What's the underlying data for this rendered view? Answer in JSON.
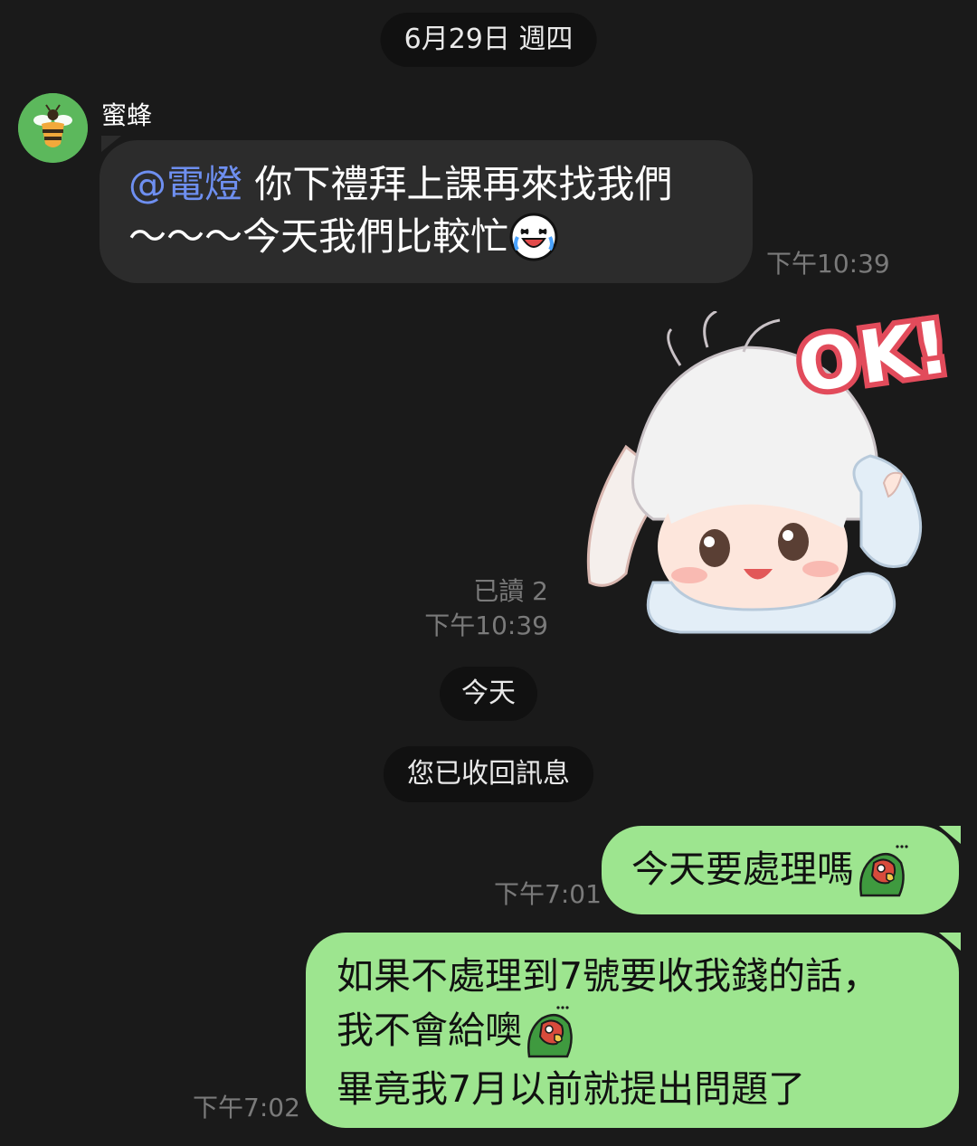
{
  "date_pill": "6月29日 週四",
  "today_pill": "今天",
  "recall_notice": "您已收回訊息",
  "incoming": {
    "sender": "蜜蜂",
    "mention": "@電燈",
    "line1": " 你下禮拜上課再來找我們",
    "line2": "～～～今天我們比較忙",
    "time": "下午10:39"
  },
  "sticker": {
    "read": "已讀 2",
    "time": "下午10:39",
    "caption": "OK!"
  },
  "outgoing": [
    {
      "lines": [
        "今天要處理嗎"
      ],
      "time": "下午7:01"
    },
    {
      "lines": [
        "如果不處理到7號要收我錢的話，",
        "我不會給噢",
        "畢竟我7月以前就提出問題了"
      ],
      "time": "下午7:02"
    }
  ],
  "colors": {
    "background": "#1a1a1a",
    "incoming_bubble": "#2c2c2c",
    "outgoing_bubble": "#9de58f",
    "mention": "#6e8ff0",
    "timestamp": "#7a7a7a"
  }
}
